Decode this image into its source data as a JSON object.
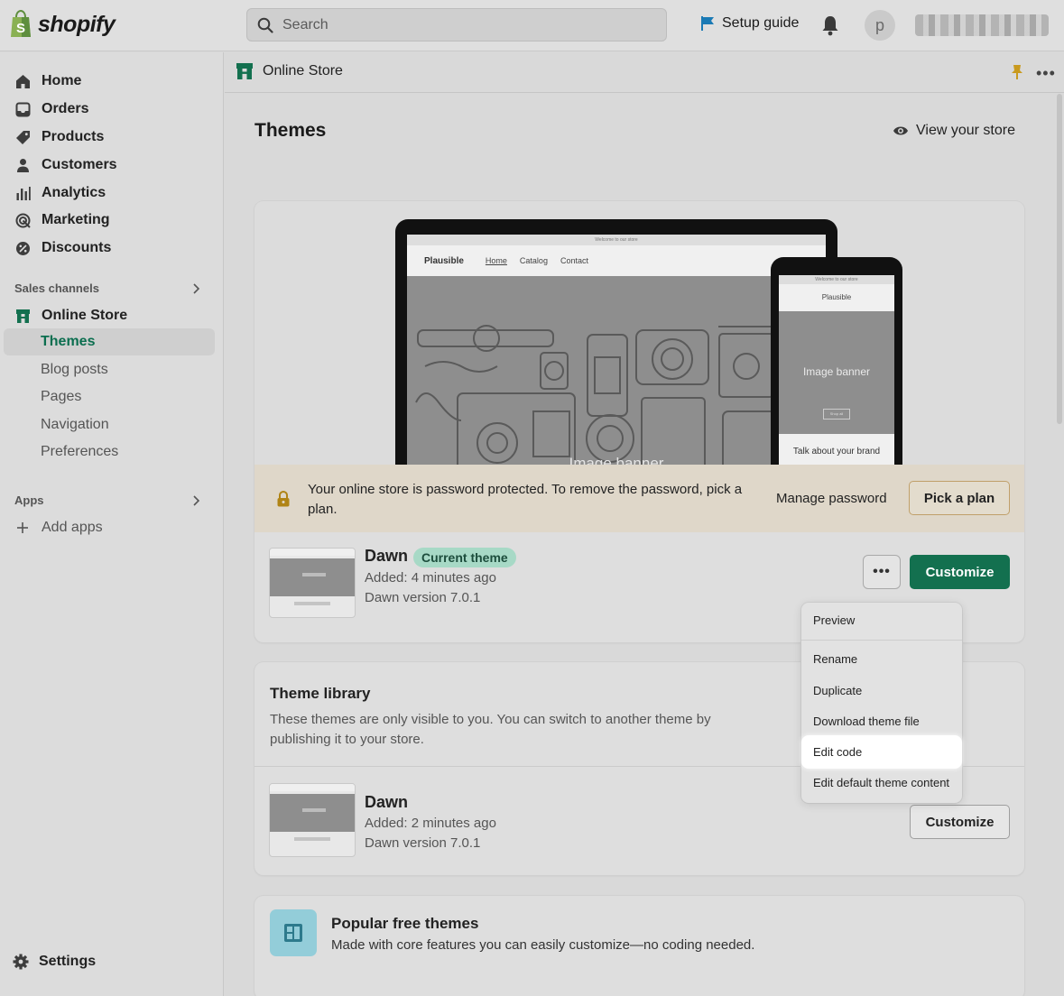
{
  "topbar": {
    "brand": "shopify",
    "search_placeholder": "Search",
    "setup_guide": "Setup guide",
    "avatar_initial": "p"
  },
  "sidebar": {
    "items": [
      {
        "label": "Home",
        "icon": "home-icon"
      },
      {
        "label": "Orders",
        "icon": "orders-icon"
      },
      {
        "label": "Products",
        "icon": "tag-icon"
      },
      {
        "label": "Customers",
        "icon": "person-icon"
      },
      {
        "label": "Analytics",
        "icon": "bar-chart-icon"
      },
      {
        "label": "Marketing",
        "icon": "target-icon"
      },
      {
        "label": "Discounts",
        "icon": "discount-icon"
      }
    ],
    "sales_channels_label": "Sales channels",
    "online_store": "Online Store",
    "sub_items": [
      "Themes",
      "Blog posts",
      "Pages",
      "Navigation",
      "Preferences"
    ],
    "apps_label": "Apps",
    "add_apps": "Add apps",
    "settings": "Settings"
  },
  "main": {
    "breadcrumb": "Online Store",
    "title": "Themes",
    "view_store": "View your store",
    "preview": {
      "laptop_top": "Welcome to our store",
      "laptop_brand": "Plausible",
      "laptop_nav": [
        "Home",
        "Catalog",
        "Contact"
      ],
      "laptop_banner": "Image banner",
      "phone_top": "Welcome to our store",
      "phone_brand": "Plausible",
      "phone_banner": "Image banner",
      "phone_button": "Shop all",
      "phone_bottom": "Talk about your brand"
    },
    "notice": {
      "text": "Your online store is password protected. To remove the password, pick a plan.",
      "manage_password": "Manage password",
      "pick_plan": "Pick a plan"
    },
    "current_theme": {
      "name": "Dawn",
      "badge": "Current theme",
      "added": "Added: 4 minutes ago",
      "version": "Dawn version 7.0.1",
      "more_label": "•••",
      "customize": "Customize"
    },
    "library": {
      "title": "Theme library",
      "description": "These themes are only visible to you. You can switch to another theme by publishing it to your store.",
      "theme": {
        "name": "Dawn",
        "added": "Added: 2 minutes ago",
        "version": "Dawn version 7.0.1",
        "customize": "Customize"
      }
    },
    "popular": {
      "title": "Popular free themes",
      "description": "Made with core features you can easily customize—no coding needed."
    }
  },
  "menu": {
    "items": [
      "Preview",
      "Rename",
      "Duplicate",
      "Download theme file",
      "Edit code",
      "Edit default theme content"
    ],
    "active": "Edit code"
  },
  "colors": {
    "primary_green": "#13704f",
    "badge_green": "#a7d9c6",
    "notice_bg": "#dfd7c9"
  }
}
